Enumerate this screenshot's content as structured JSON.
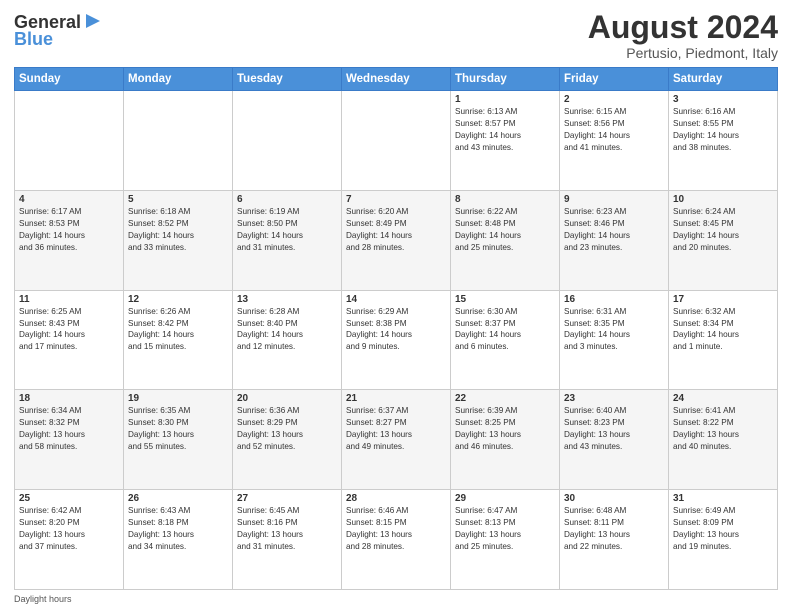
{
  "header": {
    "logo": {
      "text_general": "General",
      "text_blue": "Blue",
      "icon_unicode": "▶"
    },
    "title": "August 2024",
    "subtitle": "Pertusio, Piedmont, Italy"
  },
  "calendar": {
    "days_of_week": [
      "Sunday",
      "Monday",
      "Tuesday",
      "Wednesday",
      "Thursday",
      "Friday",
      "Saturday"
    ],
    "weeks": [
      [
        {
          "day": "",
          "info": ""
        },
        {
          "day": "",
          "info": ""
        },
        {
          "day": "",
          "info": ""
        },
        {
          "day": "",
          "info": ""
        },
        {
          "day": "1",
          "info": "Sunrise: 6:13 AM\nSunset: 8:57 PM\nDaylight: 14 hours\nand 43 minutes."
        },
        {
          "day": "2",
          "info": "Sunrise: 6:15 AM\nSunset: 8:56 PM\nDaylight: 14 hours\nand 41 minutes."
        },
        {
          "day": "3",
          "info": "Sunrise: 6:16 AM\nSunset: 8:55 PM\nDaylight: 14 hours\nand 38 minutes."
        }
      ],
      [
        {
          "day": "4",
          "info": "Sunrise: 6:17 AM\nSunset: 8:53 PM\nDaylight: 14 hours\nand 36 minutes."
        },
        {
          "day": "5",
          "info": "Sunrise: 6:18 AM\nSunset: 8:52 PM\nDaylight: 14 hours\nand 33 minutes."
        },
        {
          "day": "6",
          "info": "Sunrise: 6:19 AM\nSunset: 8:50 PM\nDaylight: 14 hours\nand 31 minutes."
        },
        {
          "day": "7",
          "info": "Sunrise: 6:20 AM\nSunset: 8:49 PM\nDaylight: 14 hours\nand 28 minutes."
        },
        {
          "day": "8",
          "info": "Sunrise: 6:22 AM\nSunset: 8:48 PM\nDaylight: 14 hours\nand 25 minutes."
        },
        {
          "day": "9",
          "info": "Sunrise: 6:23 AM\nSunset: 8:46 PM\nDaylight: 14 hours\nand 23 minutes."
        },
        {
          "day": "10",
          "info": "Sunrise: 6:24 AM\nSunset: 8:45 PM\nDaylight: 14 hours\nand 20 minutes."
        }
      ],
      [
        {
          "day": "11",
          "info": "Sunrise: 6:25 AM\nSunset: 8:43 PM\nDaylight: 14 hours\nand 17 minutes."
        },
        {
          "day": "12",
          "info": "Sunrise: 6:26 AM\nSunset: 8:42 PM\nDaylight: 14 hours\nand 15 minutes."
        },
        {
          "day": "13",
          "info": "Sunrise: 6:28 AM\nSunset: 8:40 PM\nDaylight: 14 hours\nand 12 minutes."
        },
        {
          "day": "14",
          "info": "Sunrise: 6:29 AM\nSunset: 8:38 PM\nDaylight: 14 hours\nand 9 minutes."
        },
        {
          "day": "15",
          "info": "Sunrise: 6:30 AM\nSunset: 8:37 PM\nDaylight: 14 hours\nand 6 minutes."
        },
        {
          "day": "16",
          "info": "Sunrise: 6:31 AM\nSunset: 8:35 PM\nDaylight: 14 hours\nand 3 minutes."
        },
        {
          "day": "17",
          "info": "Sunrise: 6:32 AM\nSunset: 8:34 PM\nDaylight: 14 hours\nand 1 minute."
        }
      ],
      [
        {
          "day": "18",
          "info": "Sunrise: 6:34 AM\nSunset: 8:32 PM\nDaylight: 13 hours\nand 58 minutes."
        },
        {
          "day": "19",
          "info": "Sunrise: 6:35 AM\nSunset: 8:30 PM\nDaylight: 13 hours\nand 55 minutes."
        },
        {
          "day": "20",
          "info": "Sunrise: 6:36 AM\nSunset: 8:29 PM\nDaylight: 13 hours\nand 52 minutes."
        },
        {
          "day": "21",
          "info": "Sunrise: 6:37 AM\nSunset: 8:27 PM\nDaylight: 13 hours\nand 49 minutes."
        },
        {
          "day": "22",
          "info": "Sunrise: 6:39 AM\nSunset: 8:25 PM\nDaylight: 13 hours\nand 46 minutes."
        },
        {
          "day": "23",
          "info": "Sunrise: 6:40 AM\nSunset: 8:23 PM\nDaylight: 13 hours\nand 43 minutes."
        },
        {
          "day": "24",
          "info": "Sunrise: 6:41 AM\nSunset: 8:22 PM\nDaylight: 13 hours\nand 40 minutes."
        }
      ],
      [
        {
          "day": "25",
          "info": "Sunrise: 6:42 AM\nSunset: 8:20 PM\nDaylight: 13 hours\nand 37 minutes."
        },
        {
          "day": "26",
          "info": "Sunrise: 6:43 AM\nSunset: 8:18 PM\nDaylight: 13 hours\nand 34 minutes."
        },
        {
          "day": "27",
          "info": "Sunrise: 6:45 AM\nSunset: 8:16 PM\nDaylight: 13 hours\nand 31 minutes."
        },
        {
          "day": "28",
          "info": "Sunrise: 6:46 AM\nSunset: 8:15 PM\nDaylight: 13 hours\nand 28 minutes."
        },
        {
          "day": "29",
          "info": "Sunrise: 6:47 AM\nSunset: 8:13 PM\nDaylight: 13 hours\nand 25 minutes."
        },
        {
          "day": "30",
          "info": "Sunrise: 6:48 AM\nSunset: 8:11 PM\nDaylight: 13 hours\nand 22 minutes."
        },
        {
          "day": "31",
          "info": "Sunrise: 6:49 AM\nSunset: 8:09 PM\nDaylight: 13 hours\nand 19 minutes."
        }
      ]
    ]
  },
  "footer": {
    "text": "Daylight hours"
  }
}
